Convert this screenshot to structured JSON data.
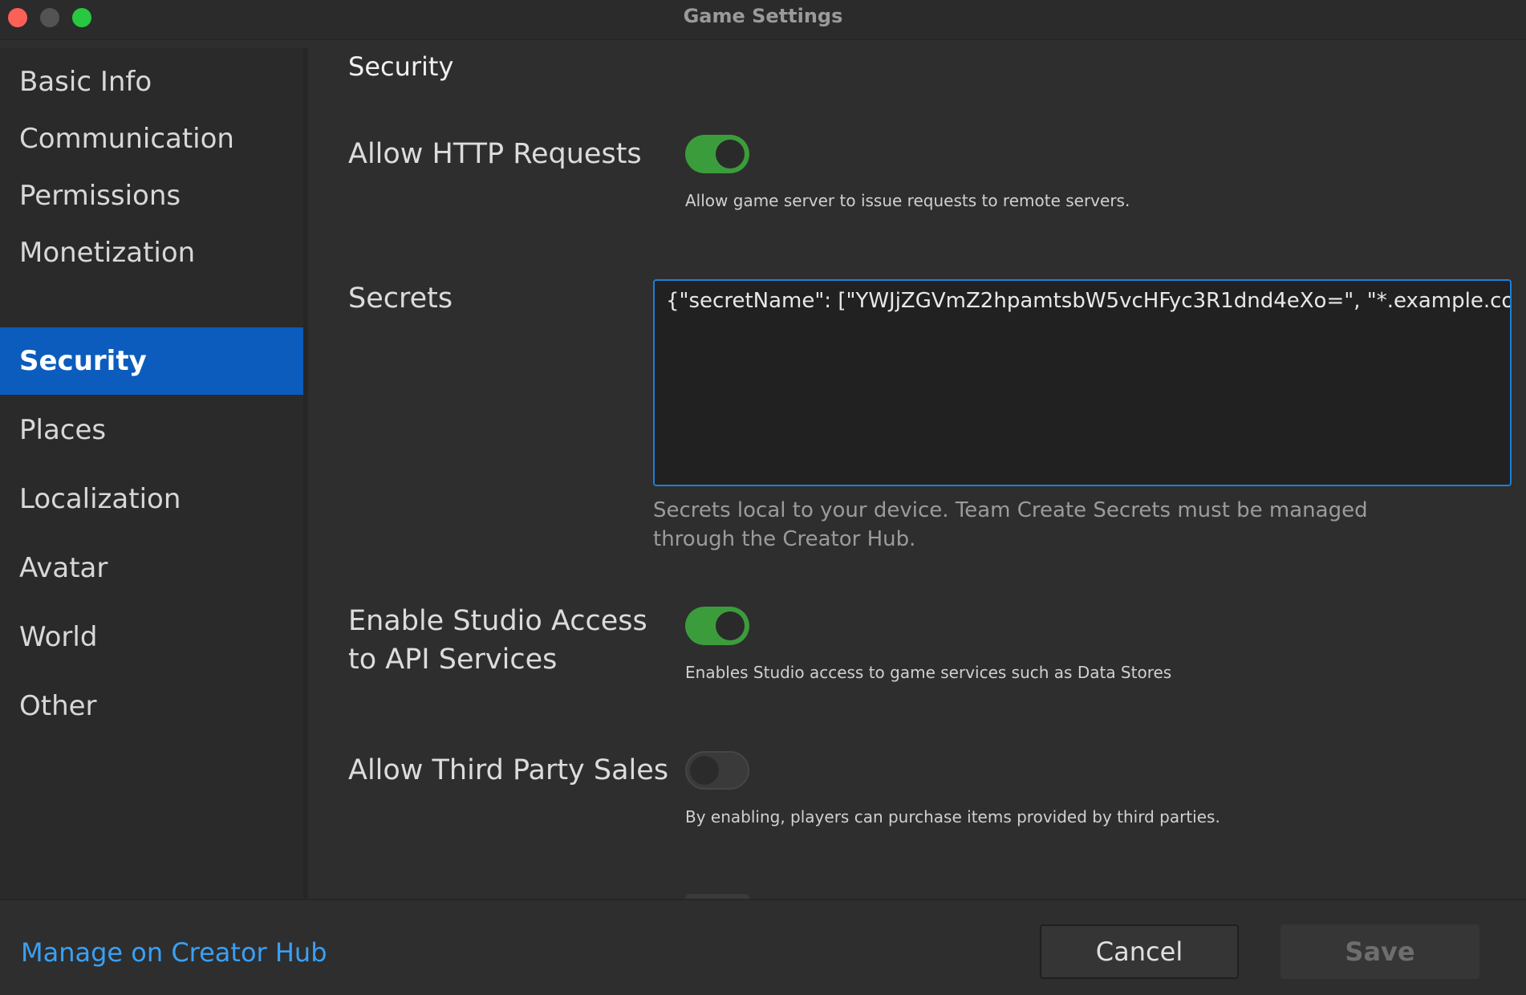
{
  "window": {
    "title": "Game Settings"
  },
  "sidebar": {
    "items": [
      {
        "label": "Basic Info"
      },
      {
        "label": "Communication"
      },
      {
        "label": "Permissions"
      },
      {
        "label": "Monetization"
      },
      {
        "label": "Security",
        "active": true
      },
      {
        "label": "Places"
      },
      {
        "label": "Localization"
      },
      {
        "label": "Avatar"
      },
      {
        "label": "World"
      },
      {
        "label": "Other"
      }
    ]
  },
  "main": {
    "section_title": "Security",
    "settings": {
      "http_requests": {
        "label": "Allow HTTP Requests",
        "enabled": true,
        "description": "Allow game server to issue requests to remote servers."
      },
      "secrets": {
        "label": "Secrets",
        "value": "{\"secretName\": [\"YWJjZGVmZ2hpamtsbW5vcHFyc3R1dnd4eXo=\", \"*.example.com\"]}",
        "note": "Secrets local to your device. Team Create Secrets must be managed through the Creator Hub."
      },
      "studio_api_access": {
        "label": "Enable Studio Access to API Services",
        "enabled": true,
        "description": "Enables Studio access to game services such as Data Stores"
      },
      "third_party_sales": {
        "label": "Allow Third Party Sales",
        "enabled": false,
        "description": "By enabling, players can purchase items provided by third parties."
      }
    }
  },
  "footer": {
    "link_label": "Manage on Creator Hub",
    "cancel_label": "Cancel",
    "save_label": "Save"
  },
  "colors": {
    "accent": "#0b5cbd",
    "toggle_on": "#3b9c3b",
    "link": "#3aa0f3",
    "focus_border": "#1e7fd9"
  }
}
